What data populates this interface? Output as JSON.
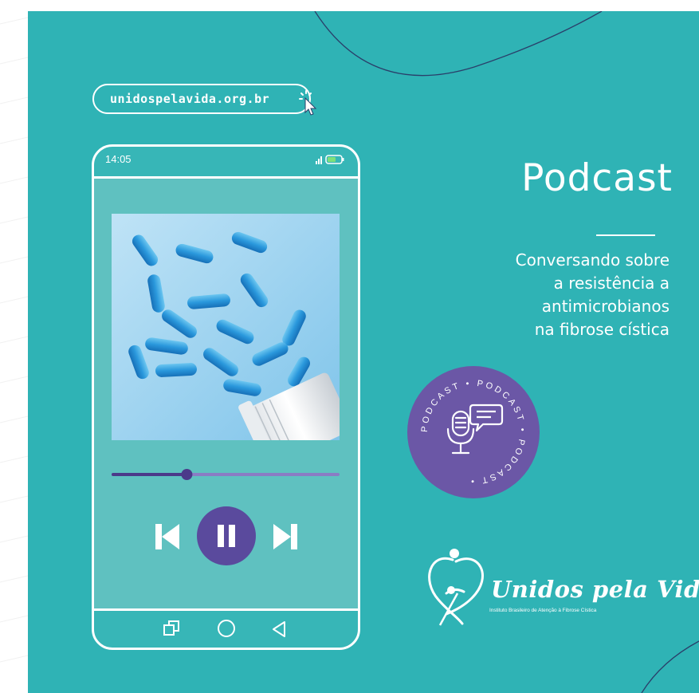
{
  "website": {
    "url": "unidospelavida.org.br"
  },
  "phone": {
    "status_time": "14:05",
    "player": {
      "progress": 0.33,
      "controls": [
        "previous",
        "pause",
        "next"
      ]
    },
    "nav_buttons": [
      "recent-apps",
      "home",
      "back"
    ]
  },
  "episode": {
    "title": "Podcast",
    "subtitle_lines": [
      "Conversando sobre",
      "a resistência a",
      "antimicrobianos",
      "na fibrose cística"
    ]
  },
  "badge": {
    "ring_text": "PODCAST • PODCAST • PODCAST •"
  },
  "brand": {
    "name": "Unidos pela Vida",
    "tagline": "Instituto Brasileiro de Atenção à Fibrose Cística"
  },
  "colors": {
    "background": "#2fb3b5",
    "screen": "#5fc1c0",
    "accent_purple": "#6b57a6",
    "white": "#ffffff"
  }
}
